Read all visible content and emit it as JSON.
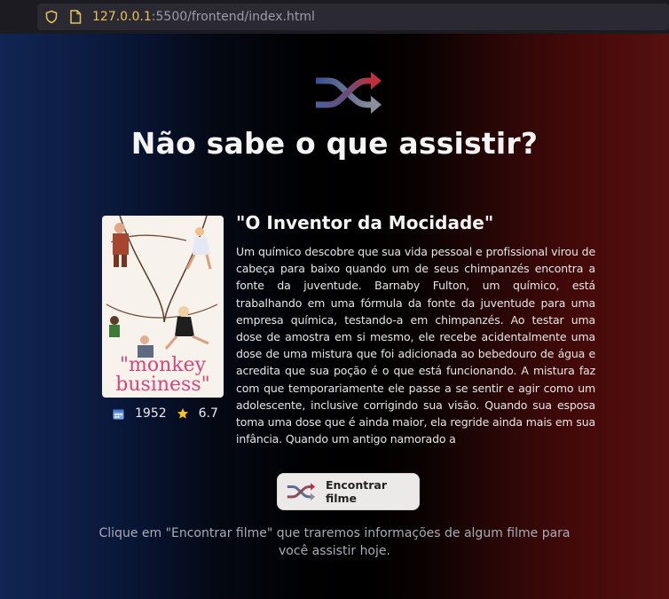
{
  "browser": {
    "url_host": "127.0.0.1",
    "url_rest": ":5500/frontend/index.html"
  },
  "hero": {
    "headline": "Não sabe o que assistir?",
    "icon": "shuffle-icon"
  },
  "movie": {
    "poster_title_line1": "\"monkey",
    "poster_title_line2": "business\"",
    "year": "1952",
    "rating": "6.7",
    "title": "\"O Inventor da Mocidade\"",
    "overview": "Um químico descobre que sua vida pessoal e profissional virou de cabeça para baixo quando um de seus chimpanzés encontra a fonte da juventude. Barnaby Fulton, um químico, está trabalhando em uma fórmula da fonte da juventude para uma empresa química, testando-a em chimpanzés. Ao testar uma dose de amostra em si mesmo, ele recebe acidentalmente uma dose de uma mistura que foi adicionada ao bebedouro de água e acredita que sua poção é o que está funcionando. A mistura faz com que temporariamente ele passe a se sentir e agir como um adolescente, inclusive corrigindo sua visão. Quando sua esposa toma uma dose que é ainda maior, ela regride ainda mais em sua infância. Quando um antigo namorado a"
  },
  "actions": {
    "find_button_label": "Encontrar filme"
  },
  "footer": {
    "hint": "Clique em \"Encontrar filme\" que traremos informações de algum filme para você assistir hoje."
  },
  "colors": {
    "gradient_left": "#102553",
    "gradient_right": "#561010",
    "shuffle_top": "#b33040",
    "shuffle_bottom": "#5b6fa8",
    "star": "#f5c518",
    "calendar": "#7aa7e8"
  }
}
